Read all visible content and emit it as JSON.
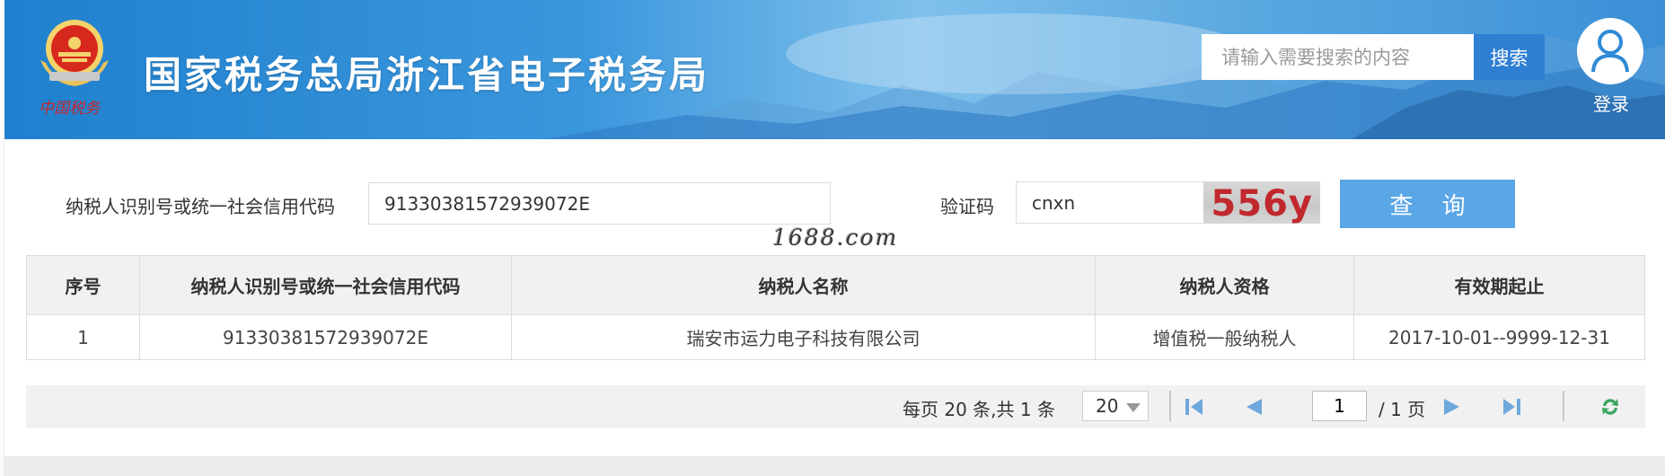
{
  "header": {
    "site_title": "国家税务总局浙江省电子税务局",
    "logo_text": "中国税务",
    "search_placeholder": "请输入需要搜索的内容",
    "search_button": "搜索",
    "login_label": "登录"
  },
  "query": {
    "taxpayer_id_label": "纳税人识别号或统一社会信用代码",
    "taxpayer_id_value": "91330381572939072E",
    "captcha_label": "验证码",
    "captcha_value": "cnxn",
    "captcha_image_text": "556y",
    "query_button": "查 询"
  },
  "watermark": "1688.com",
  "table": {
    "headers": [
      "序号",
      "纳税人识别号或统一社会信用代码",
      "纳税人名称",
      "纳税人资格",
      "有效期起止"
    ],
    "rows": [
      [
        "1",
        "91330381572939072E",
        "瑞安市运力电子科技有限公司",
        "增值税一般纳税人",
        "2017-10-01--9999-12-31"
      ]
    ]
  },
  "pager": {
    "info": "每页 20 条,共 1 条",
    "page_size": "20",
    "current_page": "1",
    "total_pages": "/ 1 页"
  },
  "colors": {
    "banner": "#2f8ad6",
    "search_button": "#2f7fd3",
    "query_button": "#5aa6e6",
    "pager_nav": "#6fa8dc",
    "refresh": "#3aa55d"
  }
}
